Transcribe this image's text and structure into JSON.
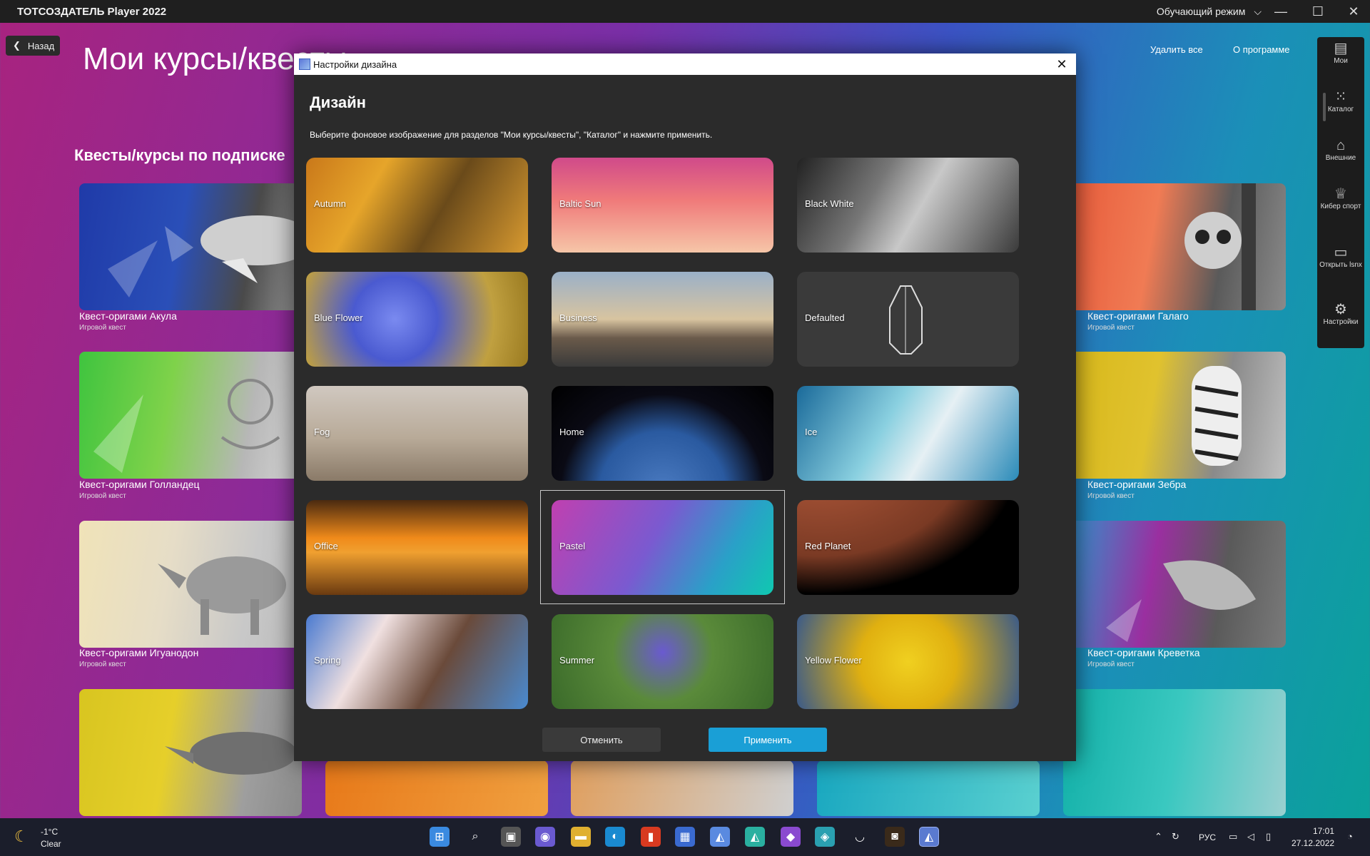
{
  "window": {
    "title": "ТОТСОЗДАТЕЛЬ Player 2022",
    "mode_label": "Обучающий режим",
    "minimize": "—",
    "maximize": "☐",
    "close": "✕"
  },
  "page": {
    "back_label": "Назад",
    "title": "Мои курсы/квесты",
    "delete_all": "Удалить все",
    "about": "О программе",
    "section_title": "Квесты/курсы по подписке"
  },
  "cards": [
    {
      "title": "Квест-оригами Акула",
      "subtitle": "Игровой квест"
    },
    {
      "title": "Квест-оригами Галаго",
      "subtitle": "Игровой квест"
    },
    {
      "title": "Квест-оригами Голландец",
      "subtitle": "Игровой квест"
    },
    {
      "title": "Квест-оригами Зебра",
      "subtitle": "Игровой квест"
    },
    {
      "title": "Квест-оригами Игуанодон",
      "subtitle": "Игровой квест"
    },
    {
      "title": "Квест-оригами Креветка",
      "subtitle": "Игровой квест"
    }
  ],
  "sidebar": {
    "items": [
      {
        "label": "Мои",
        "icon": "document-icon"
      },
      {
        "label": "Каталог",
        "icon": "grid-icon"
      },
      {
        "label": "Внешние",
        "icon": "bank-icon"
      },
      {
        "label": "Кибер спорт",
        "icon": "trophy-icon"
      },
      {
        "label": "Открыть lsnx",
        "icon": "folder-icon"
      },
      {
        "label": "Настройки",
        "icon": "gear-icon"
      }
    ]
  },
  "dialog": {
    "title": "Настройки дизайна",
    "heading": "Дизайн",
    "description": "Выберите фоновое изображение для разделов \"Мои курсы/квесты\", \"Каталог\" и нажмите применить.",
    "selected": "Pastel",
    "themes": [
      {
        "label": "Autumn"
      },
      {
        "label": "Baltic Sun"
      },
      {
        "label": "Black White"
      },
      {
        "label": "Blue Flower"
      },
      {
        "label": "Business"
      },
      {
        "label": "Defaulted"
      },
      {
        "label": "Fog"
      },
      {
        "label": "Home"
      },
      {
        "label": "Ice"
      },
      {
        "label": "Office"
      },
      {
        "label": "Pastel"
      },
      {
        "label": "Red Planet"
      },
      {
        "label": "Spring"
      },
      {
        "label": "Summer"
      },
      {
        "label": "Yellow Flower"
      }
    ],
    "cancel_label": "Отменить",
    "apply_label": "Применить",
    "apply_color": "#1a9fd6"
  },
  "taskbar": {
    "weather_temp": "-1°C",
    "weather_desc": "Clear",
    "language": "РУС",
    "time": "17:01",
    "date": "27.12.2022"
  }
}
